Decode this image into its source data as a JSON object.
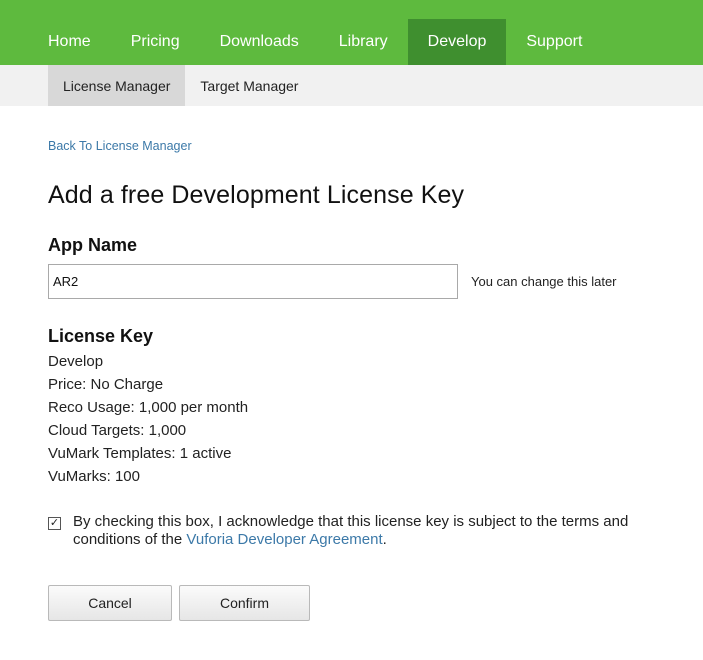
{
  "top_nav": {
    "items": [
      {
        "label": "Home"
      },
      {
        "label": "Pricing"
      },
      {
        "label": "Downloads"
      },
      {
        "label": "Library"
      },
      {
        "label": "Develop",
        "active": true
      },
      {
        "label": "Support"
      }
    ]
  },
  "sub_nav": {
    "items": [
      {
        "label": "License Manager",
        "active": true
      },
      {
        "label": "Target Manager"
      }
    ]
  },
  "back_link": "Back To License Manager",
  "page_title": "Add a free Development License Key",
  "app_name": {
    "heading": "App Name",
    "value": "AR2",
    "hint": "You can change this later"
  },
  "license_key": {
    "heading": "License Key",
    "lines": [
      "Develop",
      "Price: No Charge",
      "Reco Usage: 1,000 per month",
      "Cloud Targets: 1,000",
      "VuMark Templates: 1 active",
      "VuMarks: 100"
    ]
  },
  "agreement": {
    "checked": true,
    "check_glyph": "✓",
    "text_before": "By checking this box, I acknowledge that this license key is subject to the terms and conditions of the ",
    "link_text": "Vuforia Developer Agreement",
    "text_after": "."
  },
  "buttons": {
    "cancel_label": "Cancel",
    "confirm_label": "Confirm"
  },
  "colors": {
    "nav_green": "#5eba3e",
    "nav_active": "#3f8f2f",
    "link_blue": "#3c79a8"
  }
}
